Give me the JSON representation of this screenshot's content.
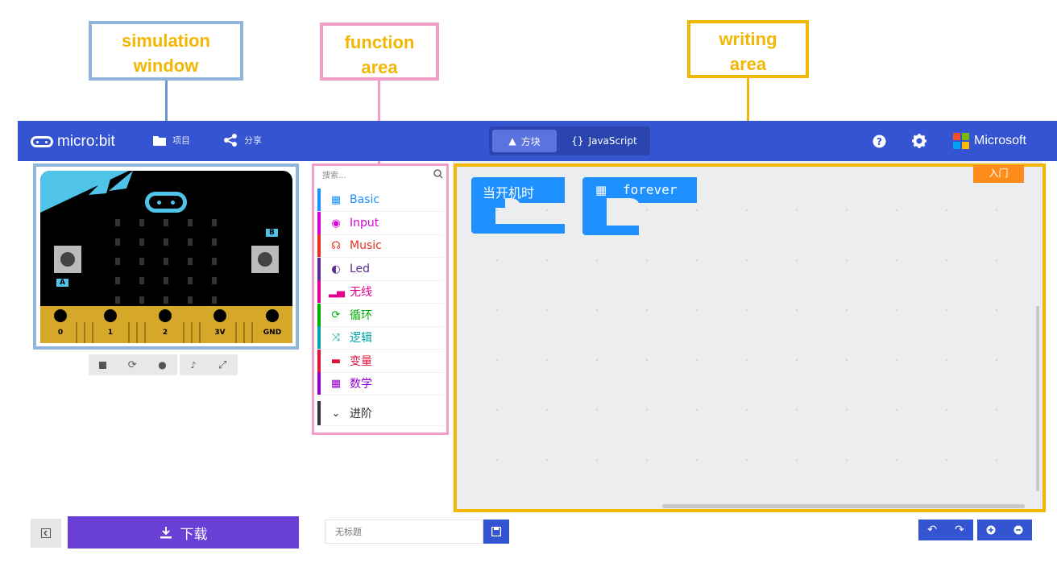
{
  "annotations": {
    "simulation": [
      "simulation",
      "window"
    ],
    "function": [
      "function",
      "area"
    ],
    "writing": [
      "writing",
      "area"
    ]
  },
  "topbar": {
    "brand": "micro:bit",
    "projects_label": "项目",
    "share_label": "分享",
    "tab_blocks": "方块",
    "tab_javascript": "JavaScript",
    "microsoft": "Microsoft"
  },
  "simulator": {
    "pins": [
      "0",
      "1",
      "2",
      "3V",
      "GND"
    ],
    "button_a": "A",
    "button_b": "B"
  },
  "toolbox": {
    "search_placeholder": "搜索...",
    "categories": [
      {
        "label": "Basic",
        "color": "#1e90ff",
        "icon": "grid-icon"
      },
      {
        "label": "Input",
        "color": "#d400d4",
        "icon": "target-icon"
      },
      {
        "label": "Music",
        "color": "#e63022",
        "icon": "headphones-icon"
      },
      {
        "label": "Led",
        "color": "#5c2d91",
        "icon": "toggle-icon"
      },
      {
        "label": "无线",
        "color": "#e3008c",
        "icon": "signal-icon"
      },
      {
        "label": "循环",
        "color": "#00aa00",
        "icon": "loop-icon"
      },
      {
        "label": "逻辑",
        "color": "#00a4a6",
        "icon": "shuffle-icon"
      },
      {
        "label": "变量",
        "color": "#dc143c",
        "icon": "variable-icon"
      },
      {
        "label": "数学",
        "color": "#9400d3",
        "icon": "calculator-icon"
      }
    ],
    "advanced": "进阶"
  },
  "workspace": {
    "on_start": "当开机时",
    "forever": "forever",
    "tutorial_button": "入门"
  },
  "bottom": {
    "download": "下载",
    "project_name_placeholder": "无标题"
  }
}
